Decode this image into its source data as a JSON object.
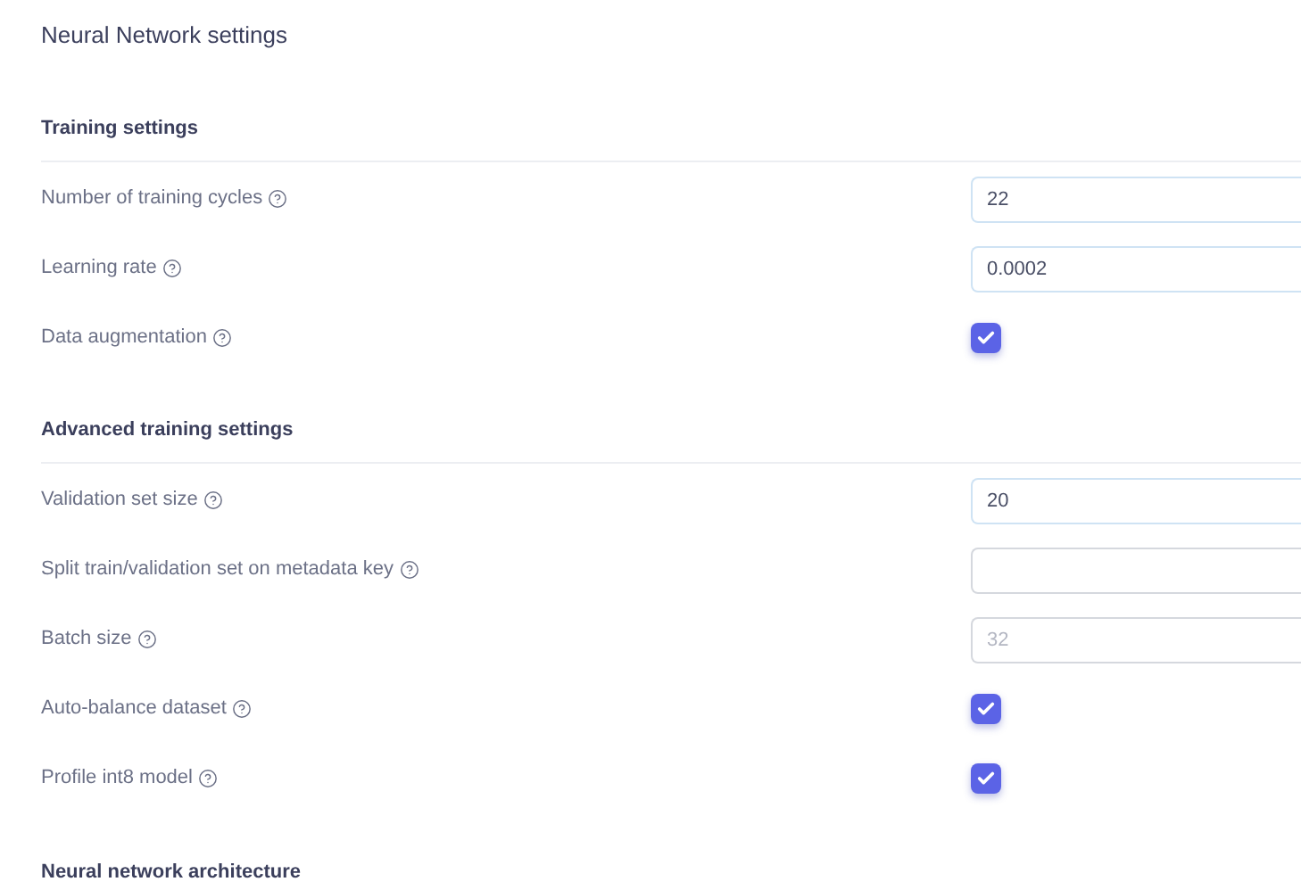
{
  "title": "Neural Network settings",
  "sections": [
    {
      "heading": "Training settings",
      "rows": [
        {
          "kind": "input",
          "label": "Number of training cycles",
          "value": "22"
        },
        {
          "kind": "input",
          "label": "Learning rate",
          "value": "0.0002"
        },
        {
          "kind": "checkbox",
          "label": "Data augmentation",
          "checked": true
        }
      ]
    },
    {
      "heading": "Advanced training settings",
      "rows": [
        {
          "kind": "input",
          "label": "Validation set size",
          "value": "20"
        },
        {
          "kind": "input",
          "label": "Split train/validation set on metadata key"
        },
        {
          "kind": "input",
          "label": "Batch size",
          "placeholder": "32"
        },
        {
          "kind": "checkbox",
          "label": "Auto-balance dataset",
          "checked": true
        },
        {
          "kind": "checkbox",
          "label": "Profile int8 model",
          "checked": true
        }
      ]
    },
    {
      "heading": "Neural network architecture"
    }
  ]
}
